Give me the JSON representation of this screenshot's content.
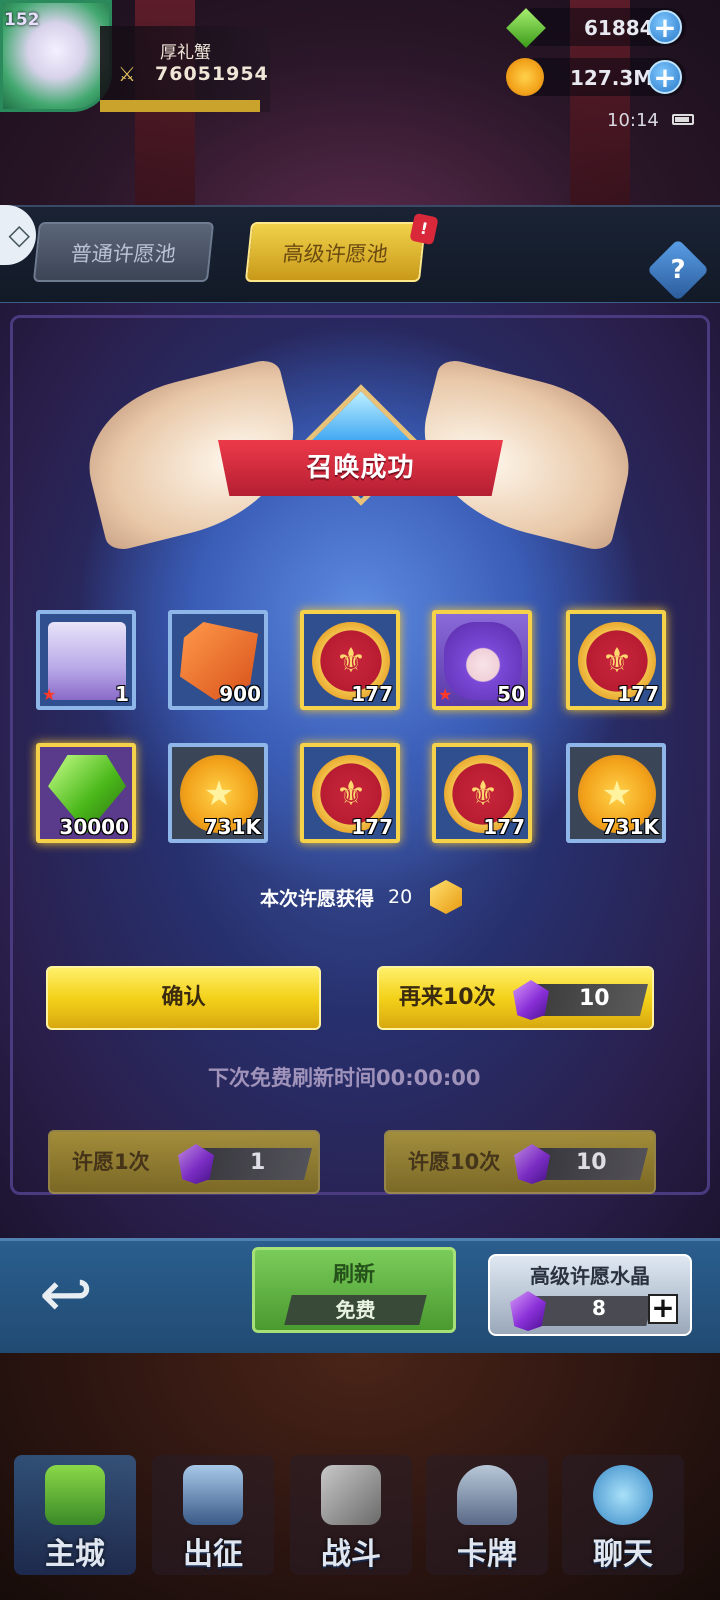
{
  "status": {
    "clock": "10:14"
  },
  "player": {
    "level": "152",
    "name": "厚礼蟹",
    "power": "76051954"
  },
  "resources": [
    {
      "name": "green-gem",
      "value": "61884",
      "color": "#4fc22a"
    },
    {
      "name": "gold-coin",
      "value": "127.3M",
      "color": "#f2b21a"
    }
  ],
  "tabs": [
    {
      "label": "普通许愿池",
      "active": false
    },
    {
      "label": "高级许愿池",
      "active": true,
      "badge": "!"
    }
  ],
  "help": {
    "label": "?"
  },
  "result": {
    "banner": "召唤成功",
    "items": [
      {
        "type": "chest",
        "qty": "1",
        "frame": "blue",
        "star": true
      },
      {
        "type": "rune-stone",
        "qty": "900",
        "frame": "blue",
        "star": false
      },
      {
        "type": "red-medal",
        "qty": "177",
        "frame": "gold",
        "star": false
      },
      {
        "type": "hero-card",
        "qty": "50",
        "frame": "gold",
        "star": true
      },
      {
        "type": "red-medal",
        "qty": "177",
        "frame": "gold",
        "star": false
      },
      {
        "type": "green-gem",
        "qty": "30000",
        "frame": "gold",
        "star": false
      },
      {
        "type": "gold-coin",
        "qty": "731K",
        "frame": "blue",
        "star": false
      },
      {
        "type": "red-medal",
        "qty": "177",
        "frame": "gold",
        "star": false
      },
      {
        "type": "red-medal",
        "qty": "177",
        "frame": "gold",
        "star": false
      },
      {
        "type": "gold-coin",
        "qty": "731K",
        "frame": "blue",
        "star": false
      }
    ],
    "earn_label": "本次许愿获得",
    "earn_value": "20"
  },
  "actions": {
    "confirm": "确认",
    "again_label": "再来10次",
    "again_cost": "10"
  },
  "free_refresh": "下次免费刷新时间00:00:00",
  "wish": [
    {
      "label": "许愿1次",
      "cost": "1"
    },
    {
      "label": "许愿10次",
      "cost": "10"
    }
  ],
  "refresh": {
    "label": "刷新",
    "sub": "免费"
  },
  "crystal": {
    "title": "高级许愿水晶",
    "count": "8"
  },
  "nav": [
    {
      "label": "主城",
      "icon": "castle-icon",
      "active": true
    },
    {
      "label": "出征",
      "icon": "banner-icon",
      "active": false
    },
    {
      "label": "战斗",
      "icon": "crossed-swords-icon",
      "active": false
    },
    {
      "label": "卡牌",
      "icon": "helmet-icon",
      "active": false
    },
    {
      "label": "聊天",
      "icon": "chat-icon",
      "active": false
    }
  ]
}
